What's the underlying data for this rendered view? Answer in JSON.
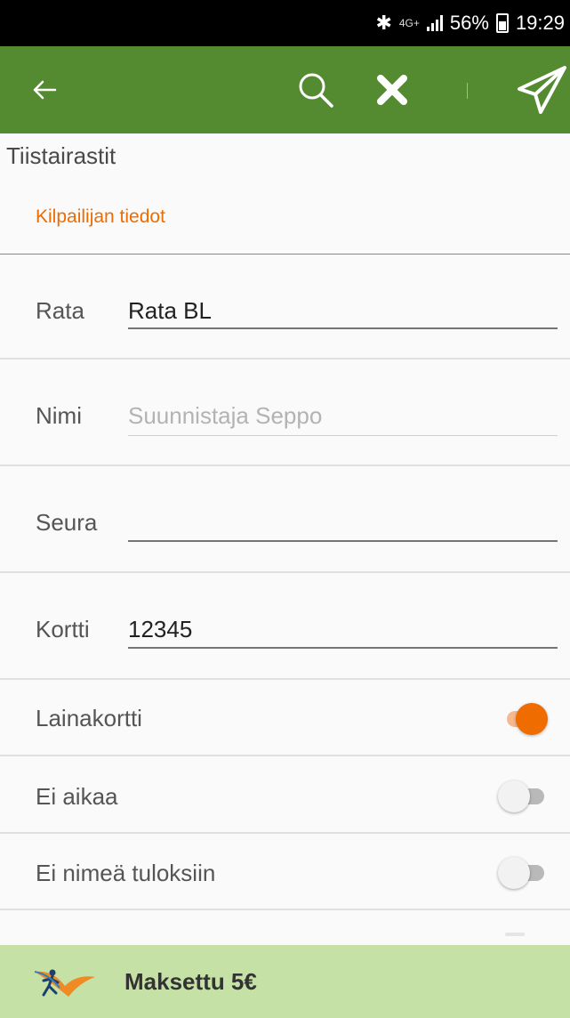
{
  "status_bar": {
    "bluetooth_icon": "bluetooth-icon",
    "network": "4G+",
    "battery_percent": "56%",
    "time": "19:29"
  },
  "toolbar": {
    "back_icon": "arrow-left-icon",
    "search_icon": "search-icon",
    "clear_icon": "close-icon",
    "send_icon": "paper-plane-icon",
    "color": "#548b30"
  },
  "screen": {
    "title": "Tiistairastit",
    "section_header": "Kilpailijan tiedot",
    "accent_color": "#ef6c00"
  },
  "form": {
    "course": {
      "label": "Rata",
      "value": "Rata BL"
    },
    "name": {
      "label": "Nimi",
      "placeholder": "Suunnistaja Seppo"
    },
    "club": {
      "label": "Seura",
      "value": ""
    },
    "card": {
      "label": "Kortti",
      "value": "12345"
    }
  },
  "toggles": [
    {
      "label": "Lainakortti",
      "on": true
    },
    {
      "label": "Ei aikaa",
      "on": false
    },
    {
      "label": "Ei nimeä tuloksiin",
      "on": false
    }
  ],
  "footer": {
    "logo_icon": "runner-logo-icon",
    "payment_status": "Maksettu 5€",
    "color": "#c5e1a5"
  }
}
